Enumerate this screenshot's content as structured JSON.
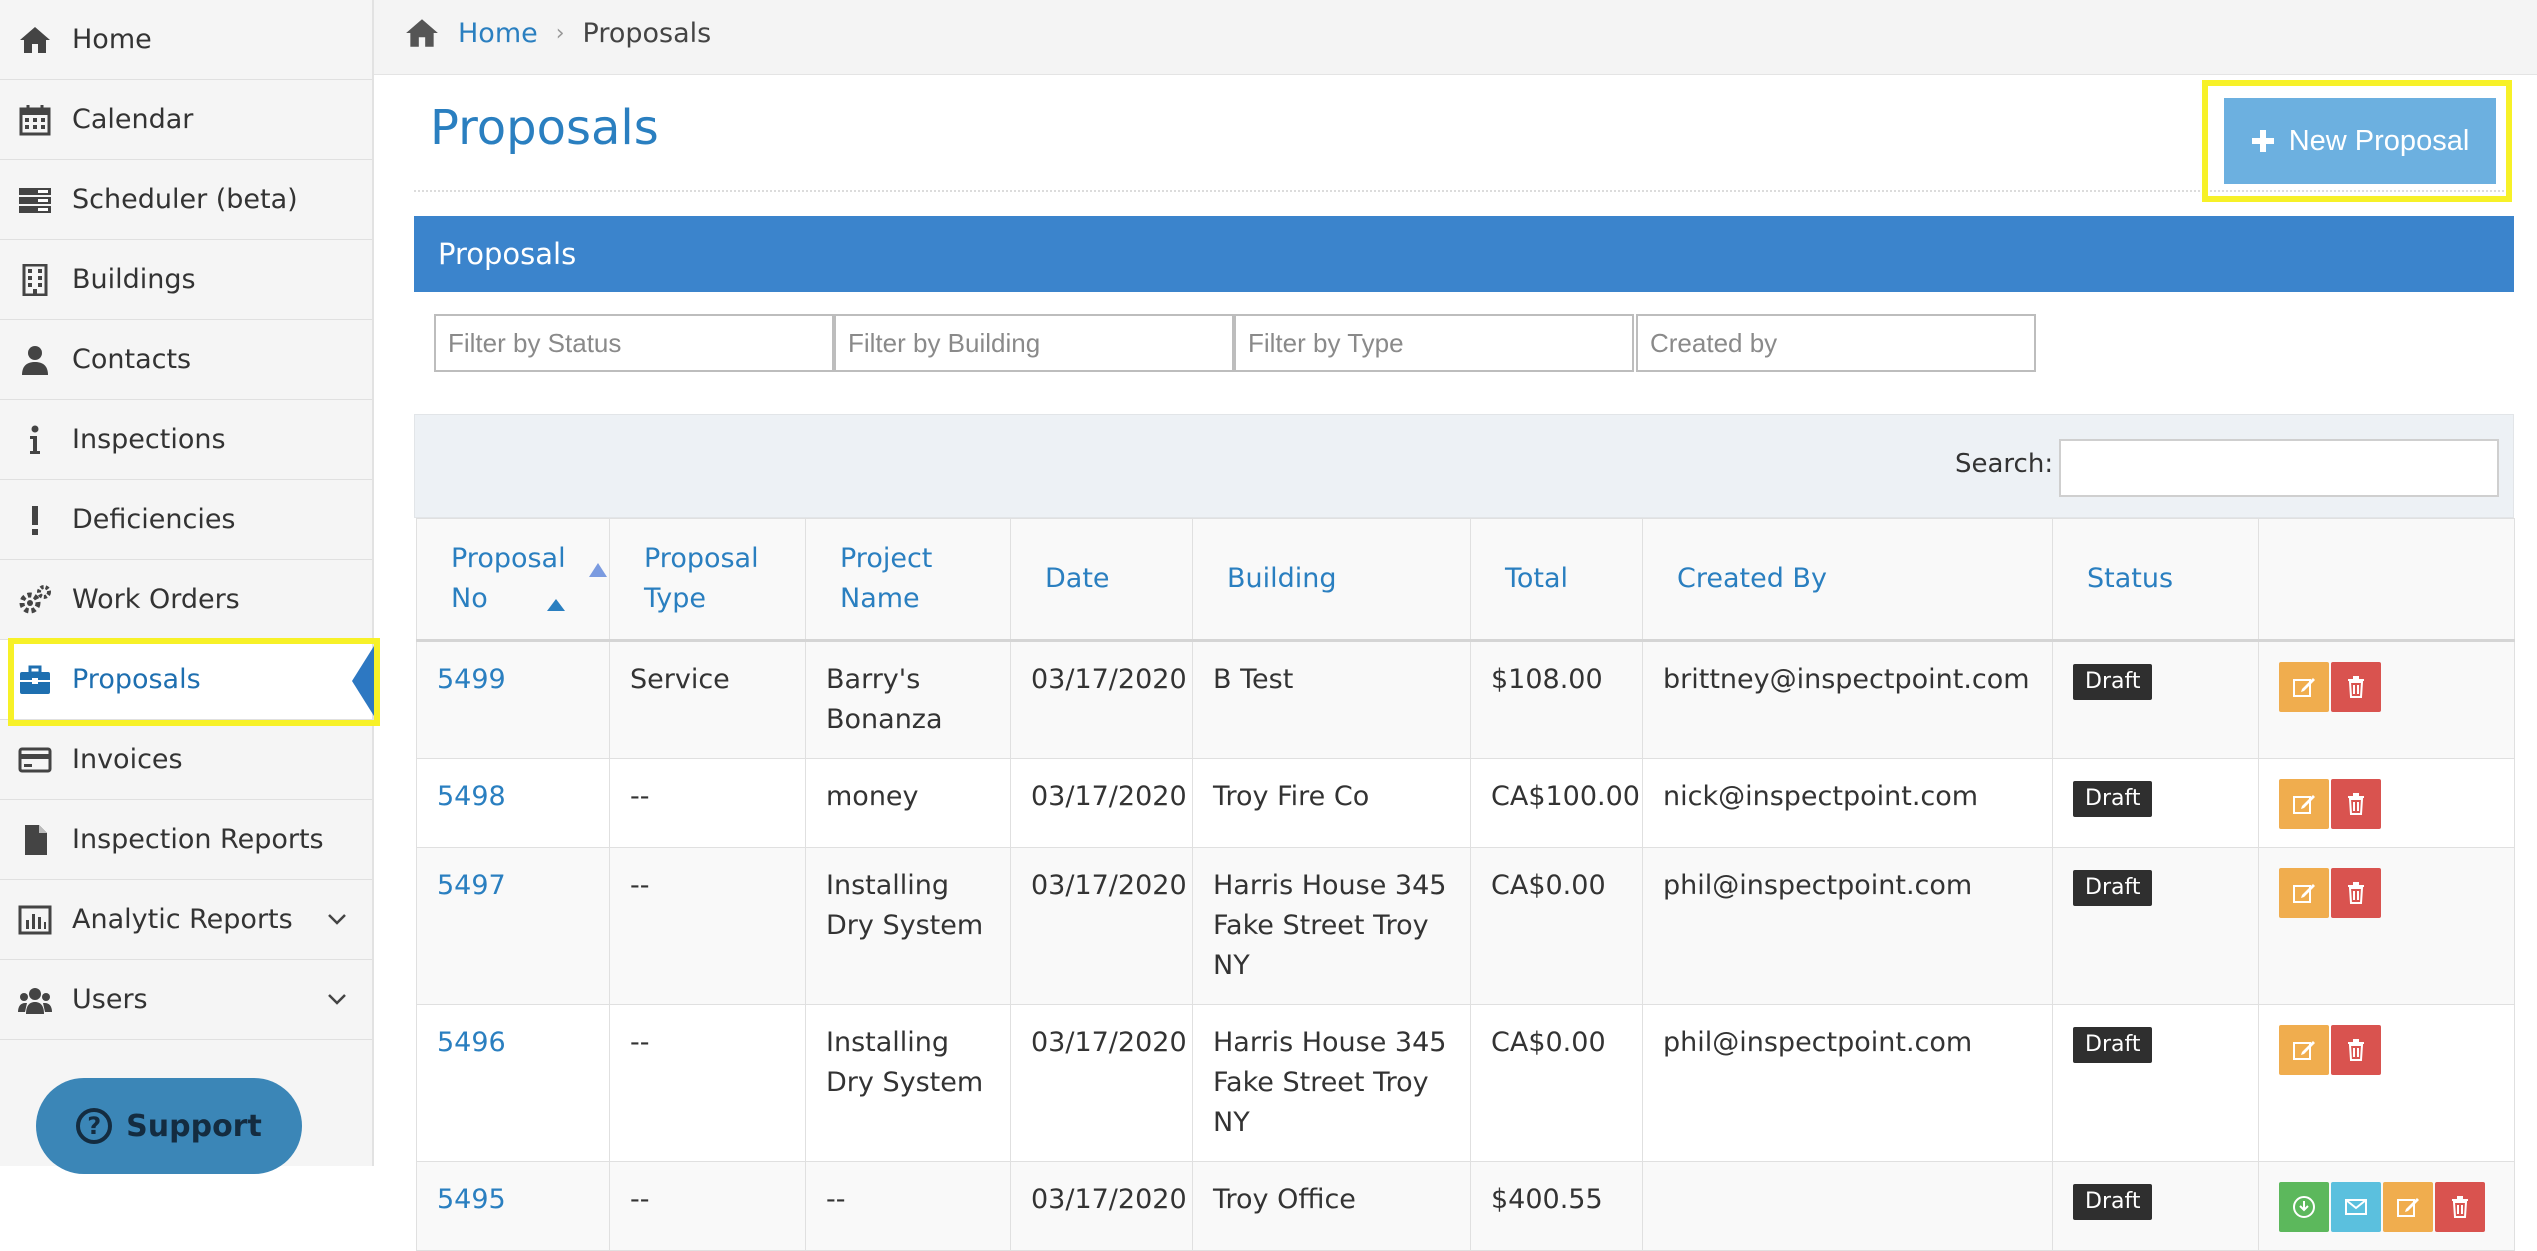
{
  "sidebar": {
    "items": [
      {
        "label": "Home",
        "icon": "home-icon"
      },
      {
        "label": "Calendar",
        "icon": "calendar-icon"
      },
      {
        "label": "Scheduler (beta)",
        "icon": "scheduler-icon"
      },
      {
        "label": "Buildings",
        "icon": "building-icon"
      },
      {
        "label": "Contacts",
        "icon": "user-icon"
      },
      {
        "label": "Inspections",
        "icon": "info-icon"
      },
      {
        "label": "Deficiencies",
        "icon": "exclamation-icon"
      },
      {
        "label": "Work Orders",
        "icon": "gears-icon"
      },
      {
        "label": "Proposals",
        "icon": "briefcase-icon",
        "active": true
      },
      {
        "label": "Invoices",
        "icon": "credit-card-icon"
      },
      {
        "label": "Inspection Reports",
        "icon": "file-icon"
      },
      {
        "label": "Analytic Reports",
        "icon": "bar-chart-icon",
        "expandable": true
      },
      {
        "label": "Users",
        "icon": "users-icon",
        "expandable": true
      }
    ],
    "support_label": "Support"
  },
  "breadcrumb": {
    "home": "Home",
    "current": "Proposals"
  },
  "page": {
    "title": "Proposals",
    "new_button": "New Proposal"
  },
  "panel": {
    "title": "Proposals"
  },
  "filters": {
    "status_placeholder": "Filter by Status",
    "building_placeholder": "Filter by Building",
    "type_placeholder": "Filter by Type",
    "created_placeholder": "Created by"
  },
  "search": {
    "label": "Search:",
    "value": ""
  },
  "table": {
    "headers": {
      "no_line1": "Proposal",
      "no_line2": "No",
      "type_line1": "Proposal",
      "type_line2": "Type",
      "name_line1": "Project",
      "name_line2": "Name",
      "date": "Date",
      "building": "Building",
      "total": "Total",
      "created_by": "Created By",
      "status": "Status"
    },
    "rows": [
      {
        "no": "5499",
        "type": "Service",
        "name": "Barry's Bonanza",
        "date": "03/17/2020",
        "building": "B Test",
        "total": "$108.00",
        "created_by": "brittney@inspectpoint.com",
        "status": "Draft"
      },
      {
        "no": "5498",
        "type": "--",
        "name": "money",
        "date": "03/17/2020",
        "building": "Troy Fire Co",
        "total": "CA$100.00",
        "created_by": "nick@inspectpoint.com",
        "status": "Draft"
      },
      {
        "no": "5497",
        "type": "--",
        "name": "Installing Dry System",
        "date": "03/17/2020",
        "building": "Harris House 345 Fake Street Troy NY",
        "total": "CA$0.00",
        "created_by": "phil@inspectpoint.com",
        "status": "Draft"
      },
      {
        "no": "5496",
        "type": "--",
        "name": "Installing Dry System",
        "date": "03/17/2020",
        "building": "Harris House 345 Fake Street Troy NY",
        "total": "CA$0.00",
        "created_by": "phil@inspectpoint.com",
        "status": "Draft"
      },
      {
        "no": "5495",
        "type": "--",
        "name": "--",
        "date": "03/17/2020",
        "building": "Troy Office",
        "total": "$400.55",
        "created_by": "",
        "status": "Draft"
      }
    ]
  },
  "colors": {
    "accent": "#2a7fc0",
    "panel": "#3b84cc",
    "highlight": "#f7f128",
    "new_button": "#6cb0e0",
    "edit": "#f0ad4e",
    "delete": "#d9534f",
    "download": "#5cb85c",
    "email": "#5bc0de"
  }
}
